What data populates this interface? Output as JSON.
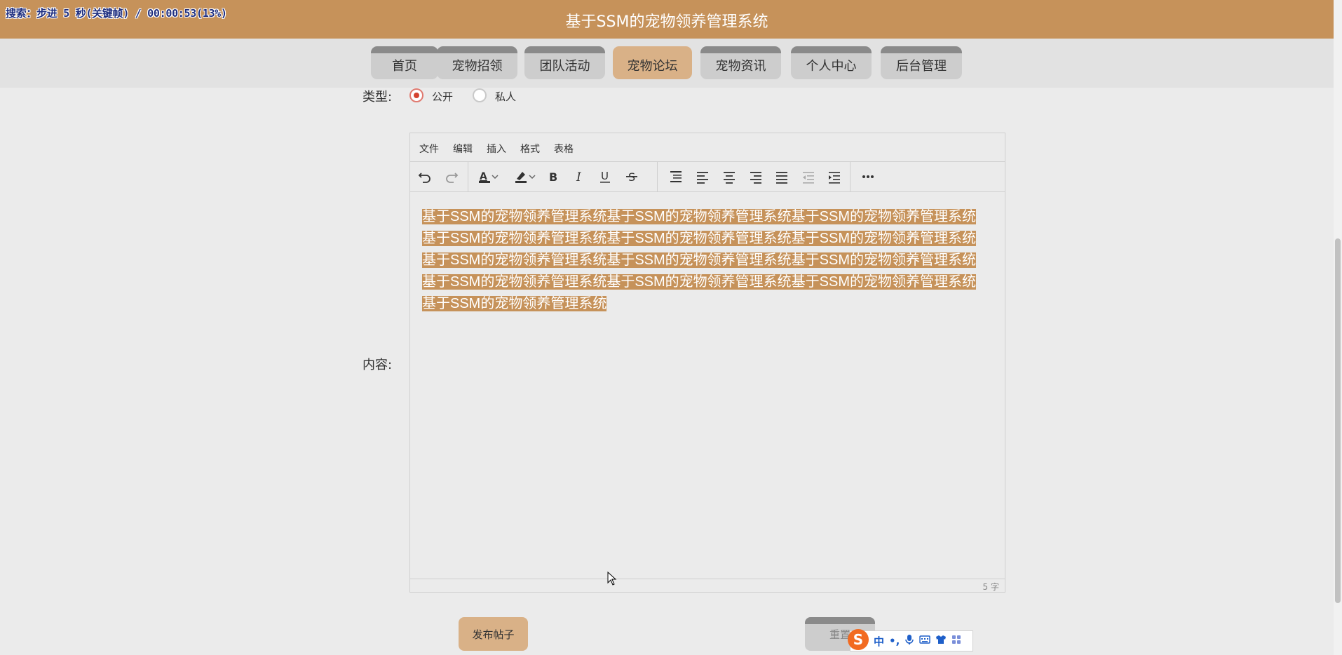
{
  "overlay": {
    "text": "搜索：步进 5 秒(关键帧) / 00:00:53(13%)"
  },
  "header": {
    "title": "基于SSM的宠物领养管理系统"
  },
  "nav": {
    "items": [
      {
        "label": "首页"
      },
      {
        "label": "宠物招领"
      },
      {
        "label": "团队活动"
      },
      {
        "label": "宠物论坛"
      },
      {
        "label": "宠物资讯"
      },
      {
        "label": "个人中心"
      },
      {
        "label": "后台管理"
      }
    ],
    "active": "宠物论坛"
  },
  "form": {
    "type_label": "类型:",
    "type_options": [
      {
        "label": "公开",
        "checked": true
      },
      {
        "label": "私人",
        "checked": false
      }
    ],
    "content_label": "内容:",
    "publish_label": "发布帖子",
    "reset_label": "重置"
  },
  "editor": {
    "menu": [
      "文件",
      "编辑",
      "插入",
      "格式",
      "表格"
    ],
    "toolbar_icons": [
      "undo-icon",
      "redo-icon",
      "font-color-icon",
      "highlight-color-icon",
      "bold-icon",
      "italic-icon",
      "underline-icon",
      "strikethrough-icon",
      "line-height-icon",
      "align-left-icon",
      "align-center-icon",
      "align-right-icon",
      "align-justify-icon",
      "outdent-icon",
      "indent-icon",
      "more-icon"
    ],
    "content": "基于SSM的宠物领养管理系统基于SSM的宠物领养管理系统基于SSM的宠物领养管理系统基于SSM的宠物领养管理系统基于SSM的宠物领养管理系统基于SSM的宠物领养管理系统基于SSM的宠物领养管理系统基于SSM的宠物领养管理系统基于SSM的宠物领养管理系统基于SSM的宠物领养管理系统基于SSM的宠物领养管理系统基于SSM的宠物领养管理系统基于SSM的宠物领养管理系统",
    "word_count": "5 字"
  },
  "ime": {
    "logo": "S",
    "items": [
      "中",
      "•,"
    ]
  },
  "colors": {
    "brand": "#c6925a",
    "active_tab": "#d9b187",
    "radio_checked": "#d4422f"
  }
}
